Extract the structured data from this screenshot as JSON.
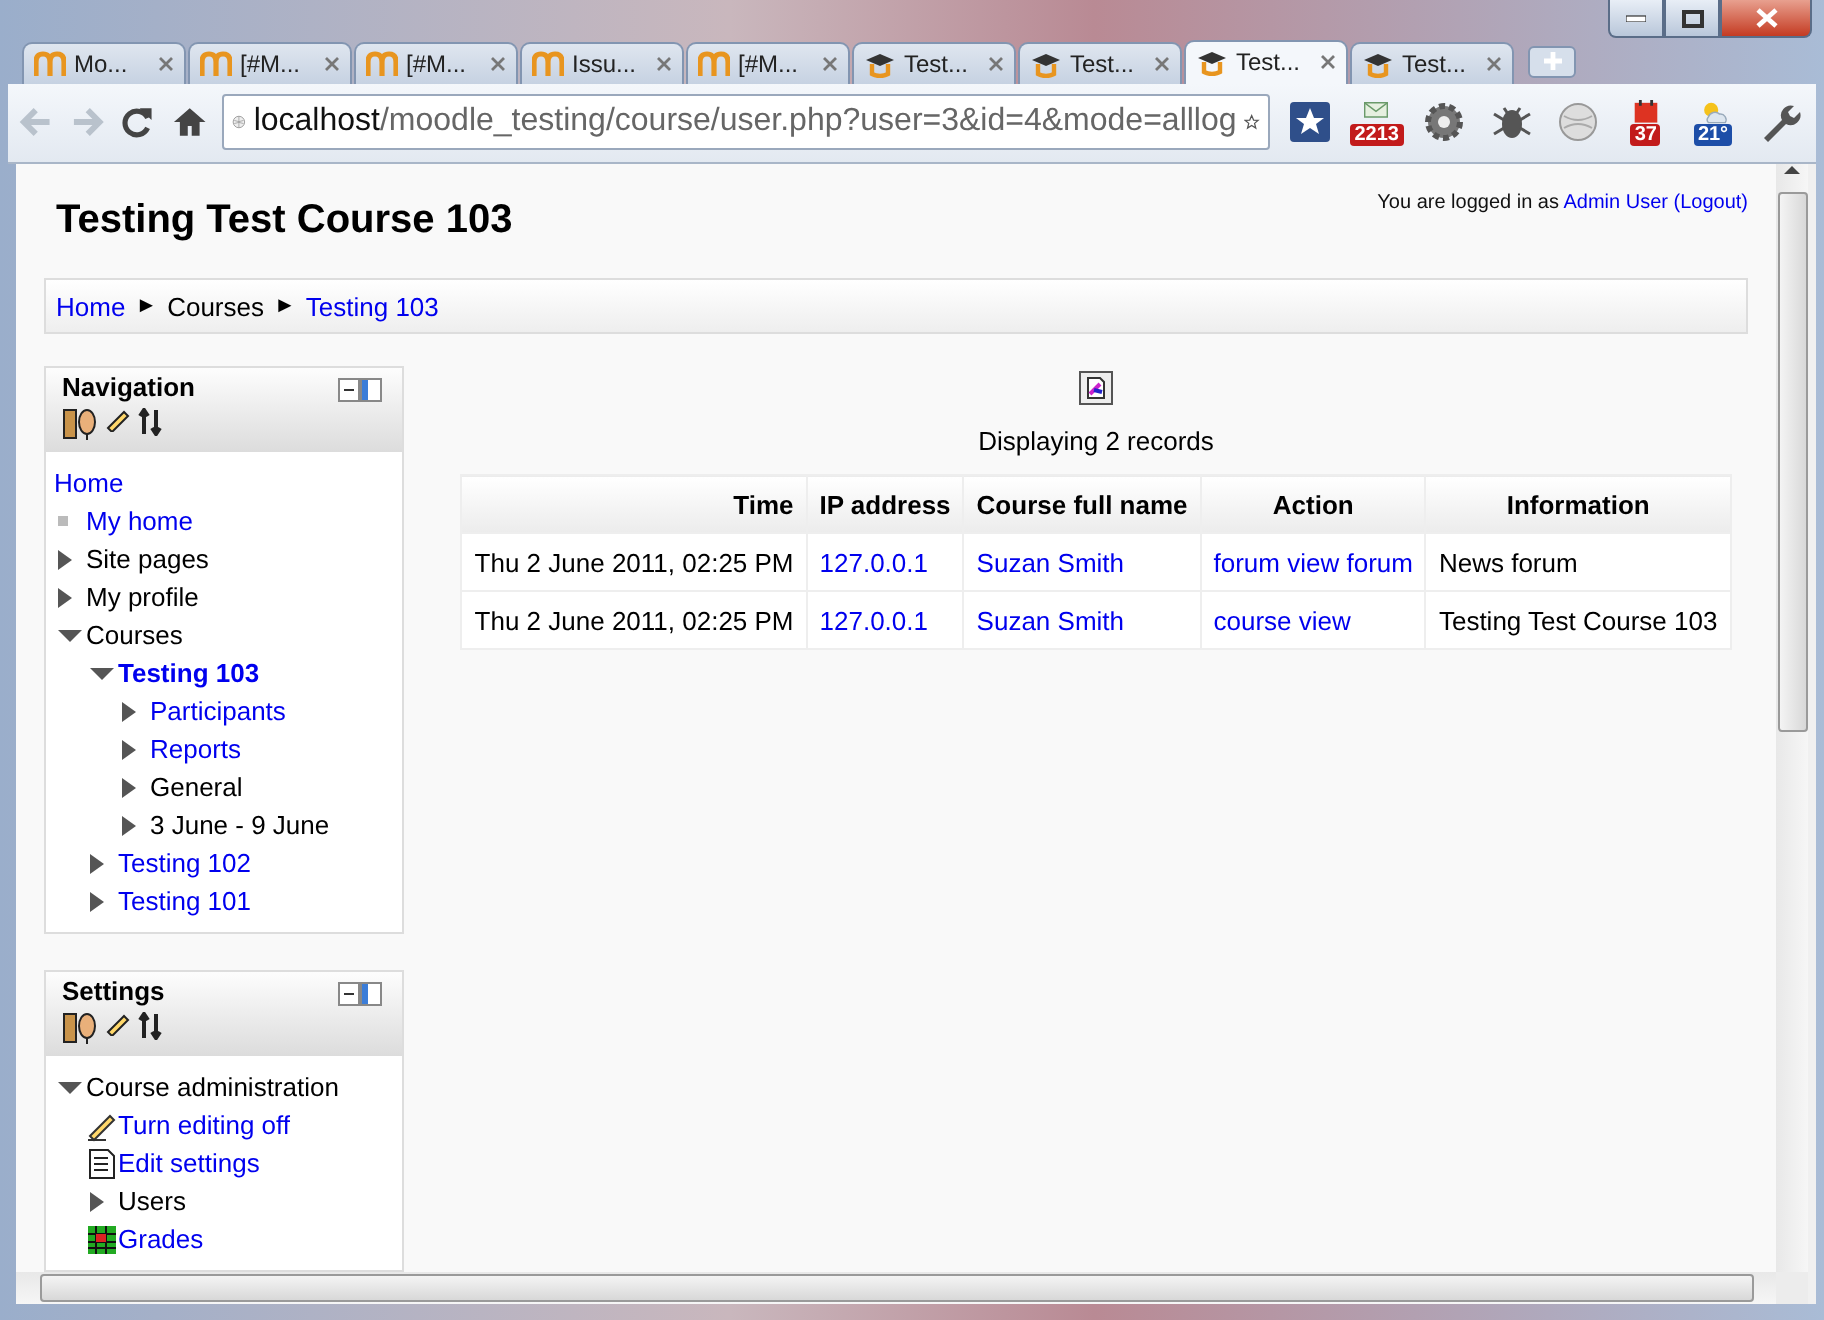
{
  "browser": {
    "tabs": [
      {
        "title": "Mo...",
        "kind": "moodle",
        "selected": false
      },
      {
        "title": "[#M...",
        "kind": "moodle",
        "selected": false
      },
      {
        "title": "[#M...",
        "kind": "moodle",
        "selected": false
      },
      {
        "title": "Issu...",
        "kind": "moodle",
        "selected": false
      },
      {
        "title": "[#M...",
        "kind": "moodle",
        "selected": false
      },
      {
        "title": "Test...",
        "kind": "hat",
        "selected": false
      },
      {
        "title": "Test...",
        "kind": "hat",
        "selected": false
      },
      {
        "title": "Test...",
        "kind": "hat",
        "selected": true
      },
      {
        "title": "Test...",
        "kind": "hat",
        "selected": false
      }
    ],
    "address": {
      "host": "localhost",
      "path": "/moodle_testing/course/user.php?user=3&id=4&mode=alllog"
    },
    "extensions": [
      {
        "kind": "bookmark"
      },
      {
        "kind": "mail",
        "badge": "2213"
      },
      {
        "kind": "gear"
      },
      {
        "kind": "bug"
      },
      {
        "kind": "globe"
      },
      {
        "kind": "calendar",
        "badge": "37"
      },
      {
        "kind": "weather",
        "badge": "21°"
      },
      {
        "kind": "wrench"
      }
    ]
  },
  "page": {
    "title": "Testing Test Course 103",
    "login": {
      "prefix": "You are logged in as",
      "user": "Admin User",
      "logout": "(Logout)"
    },
    "breadcrumb": [
      {
        "kind": "link",
        "text": "Home"
      },
      {
        "kind": "separator",
        "text": "►"
      },
      {
        "kind": "text",
        "text": "Courses"
      },
      {
        "kind": "separator",
        "text": "►"
      },
      {
        "kind": "link",
        "text": "Testing 103"
      }
    ],
    "blocks": [
      {
        "title": "Navigation",
        "tree": [
          {
            "label": "Home",
            "kind": "plain",
            "link": true,
            "current": false
          },
          {
            "label": "My home",
            "kind": "bullet",
            "link": true,
            "current": false
          },
          {
            "label": "Site pages",
            "kind": "collapsed",
            "link": false,
            "current": false
          },
          {
            "label": "My profile",
            "kind": "collapsed",
            "link": false,
            "current": false
          },
          {
            "label": "Courses",
            "kind": "expanded",
            "link": false,
            "current": false,
            "children": [
              {
                "label": "Testing 103",
                "kind": "expanded",
                "link": true,
                "current": true,
                "children": [
                  {
                    "label": "Participants",
                    "kind": "collapsed",
                    "link": true,
                    "current": false
                  },
                  {
                    "label": "Reports",
                    "kind": "collapsed",
                    "link": true,
                    "current": false
                  },
                  {
                    "label": "General",
                    "kind": "collapsed",
                    "link": false,
                    "current": false
                  },
                  {
                    "label": "3 June - 9 June",
                    "kind": "collapsed",
                    "link": false,
                    "current": false
                  }
                ]
              },
              {
                "label": "Testing 102",
                "kind": "collapsed",
                "link": true,
                "current": false
              },
              {
                "label": "Testing 101",
                "kind": "collapsed",
                "link": true,
                "current": false
              }
            ]
          }
        ]
      },
      {
        "title": "Settings",
        "tree": [
          {
            "label": "Course administration",
            "kind": "expanded",
            "link": false,
            "current": false,
            "children": [
              {
                "label": "Turn editing off",
                "kind": "edit",
                "link": true,
                "current": false
              },
              {
                "label": "Edit settings",
                "kind": "document",
                "link": true,
                "current": false
              },
              {
                "label": "Users",
                "kind": "collapsed",
                "link": false,
                "current": false
              },
              {
                "label": "Grades",
                "kind": "grades",
                "link": true,
                "current": false
              }
            ]
          }
        ]
      }
    ]
  },
  "main": {
    "summary": "Displaying 2 records",
    "table": {
      "columns": [
        {
          "label": "Time"
        },
        {
          "label": "IP address"
        },
        {
          "label": "Course full name"
        },
        {
          "label": "Action"
        },
        {
          "label": "Information"
        }
      ],
      "rows": [
        [
          {
            "text": "Thu 2 June 2011, 02:25 PM",
            "kind": "text"
          },
          {
            "text": "127.0.0.1",
            "kind": "link"
          },
          {
            "text": "Suzan Smith",
            "kind": "link"
          },
          {
            "text": "forum view forum",
            "kind": "link"
          },
          {
            "text": "News forum",
            "kind": "text"
          }
        ],
        [
          {
            "text": "Thu 2 June 2011, 02:25 PM",
            "kind": "text"
          },
          {
            "text": "127.0.0.1",
            "kind": "link"
          },
          {
            "text": "Suzan Smith",
            "kind": "link"
          },
          {
            "text": "course view",
            "kind": "link"
          },
          {
            "text": "Testing Test Course 103",
            "kind": "text"
          }
        ]
      ]
    }
  }
}
